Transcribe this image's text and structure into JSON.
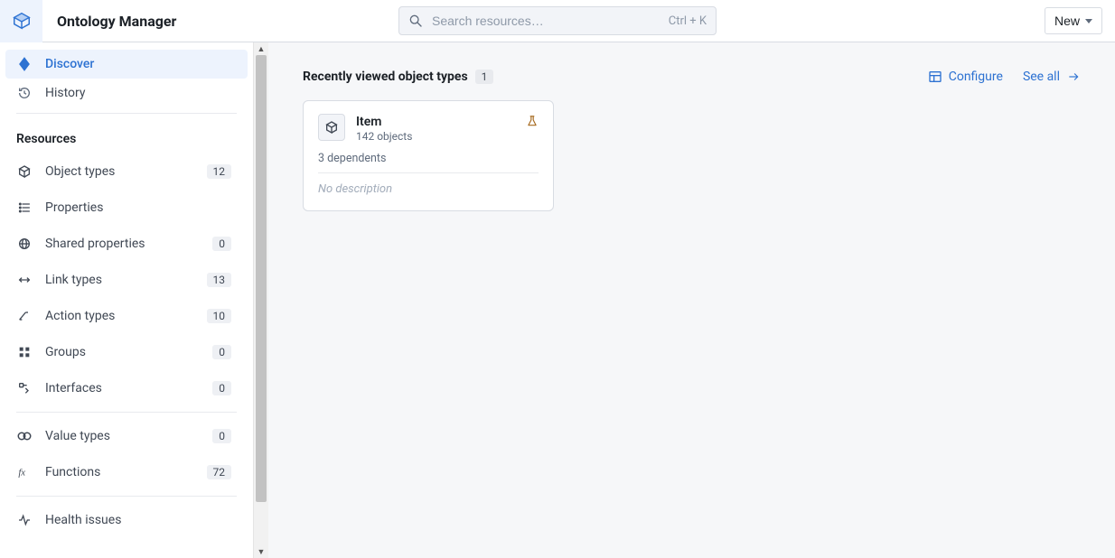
{
  "header": {
    "app_title": "Ontology Manager",
    "search_placeholder": "Search resources…",
    "search_hint": "Ctrl + K",
    "new_label": "New"
  },
  "sidebar": {
    "nav": [
      {
        "label": "Discover",
        "icon": "diamond-icon",
        "active": true
      },
      {
        "label": "History",
        "icon": "history-icon",
        "active": false
      }
    ],
    "resources_label": "Resources",
    "resources": [
      {
        "label": "Object types",
        "icon": "cube-icon",
        "count": "12"
      },
      {
        "label": "Properties",
        "icon": "properties-icon",
        "count": null
      },
      {
        "label": "Shared properties",
        "icon": "globe-icon",
        "count": "0"
      },
      {
        "label": "Link types",
        "icon": "link-icon",
        "count": "13"
      },
      {
        "label": "Action types",
        "icon": "action-icon",
        "count": "10"
      },
      {
        "label": "Groups",
        "icon": "groups-icon",
        "count": "0"
      },
      {
        "label": "Interfaces",
        "icon": "interface-icon",
        "count": "0"
      }
    ],
    "secondary": [
      {
        "label": "Value types",
        "icon": "valuetype-icon",
        "count": "0"
      },
      {
        "label": "Functions",
        "icon": "function-icon",
        "count": "72"
      }
    ],
    "tertiary": [
      {
        "label": "Health issues",
        "icon": "health-icon",
        "count": null
      }
    ]
  },
  "main": {
    "section_title": "Recently viewed object types",
    "section_count": "1",
    "configure_label": "Configure",
    "see_all_label": "See all",
    "cards": [
      {
        "title": "Item",
        "subtitle": "142 objects",
        "dependents": "3 dependents",
        "description": "No description"
      }
    ]
  }
}
